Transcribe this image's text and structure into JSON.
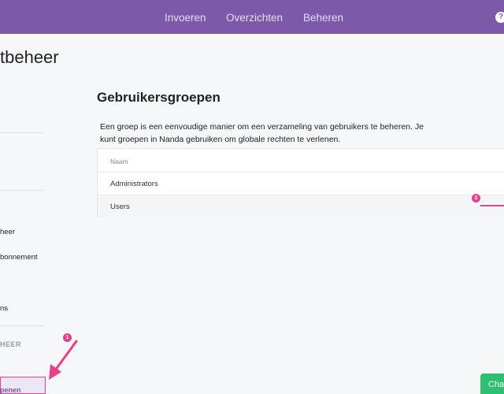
{
  "topbar": {
    "nav": [
      "Invoeren",
      "Overzichten",
      "Beheren"
    ],
    "help_icon": "?"
  },
  "page": {
    "title": "tbeheer"
  },
  "sidebar": {
    "items": [
      {
        "label": "heer",
        "type": "item"
      },
      {
        "label": "bonnement",
        "type": "item"
      },
      {
        "label": "ns",
        "type": "item"
      },
      {
        "label": "HEER",
        "type": "heading"
      },
      {
        "label": "penen",
        "type": "active"
      }
    ]
  },
  "main": {
    "title": "Gebruikersgroepen",
    "description": "Een groep is een eenvoudige manier om een verzameling van gebruikers te beheren. Je kunt groepen in Nanda gebruiken om globale rechten te verlenen.",
    "table": {
      "header": "Naam",
      "rows": [
        "Administrators",
        "Users"
      ]
    }
  },
  "annotations": {
    "badge_1": "1",
    "badge_2": "2",
    "color": "#e83e8c"
  },
  "chat": {
    "label": "Chat"
  },
  "colors": {
    "brand": "#7d59aa",
    "accent": "#e83e8c",
    "chat": "#2fbf71"
  }
}
